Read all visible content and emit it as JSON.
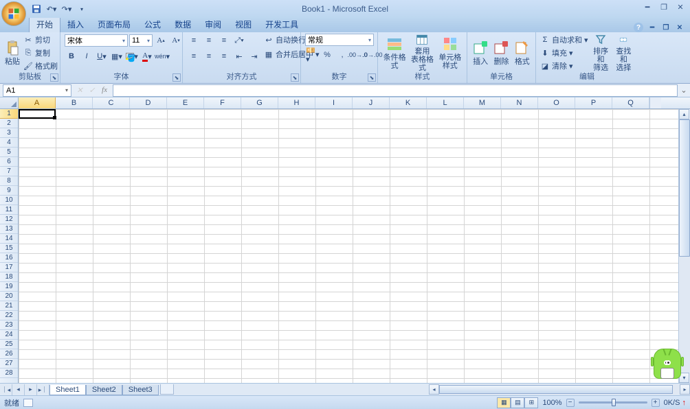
{
  "title": "Book1 - Microsoft Excel",
  "tabs": [
    "开始",
    "插入",
    "页面布局",
    "公式",
    "数据",
    "审阅",
    "视图",
    "开发工具"
  ],
  "active_tab": 0,
  "clipboard": {
    "paste": "粘贴",
    "cut": "剪切",
    "copy": "复制",
    "painter": "格式刷",
    "title": "剪贴板"
  },
  "font": {
    "family": "宋体",
    "size": "11",
    "title": "字体"
  },
  "align": {
    "wrap": "自动换行",
    "merge": "合并后居中",
    "title": "对齐方式"
  },
  "number": {
    "fmt": "常规",
    "title": "数字"
  },
  "styles": {
    "cond": "条件格式",
    "table": "套用\n表格格式",
    "cell": "单元格\n样式",
    "title": "样式"
  },
  "cellsg": {
    "insert": "插入",
    "delete": "删除",
    "format": "格式",
    "title": "单元格"
  },
  "edit": {
    "sum": "自动求和",
    "fill": "填充",
    "clear": "清除",
    "sort": "排序和\n筛选",
    "find": "查找和\n选择",
    "title": "编辑"
  },
  "namebox": "A1",
  "columns": [
    "A",
    "B",
    "C",
    "D",
    "E",
    "F",
    "G",
    "H",
    "I",
    "J",
    "K",
    "L",
    "M",
    "N",
    "O",
    "P",
    "Q"
  ],
  "rows": 28,
  "sheets": [
    "Sheet1",
    "Sheet2",
    "Sheet3"
  ],
  "active_sheet": 0,
  "status": "就绪",
  "zoom": "100%",
  "speed": "0K/S",
  "speed_up": "↑",
  "speed_down": "↓"
}
